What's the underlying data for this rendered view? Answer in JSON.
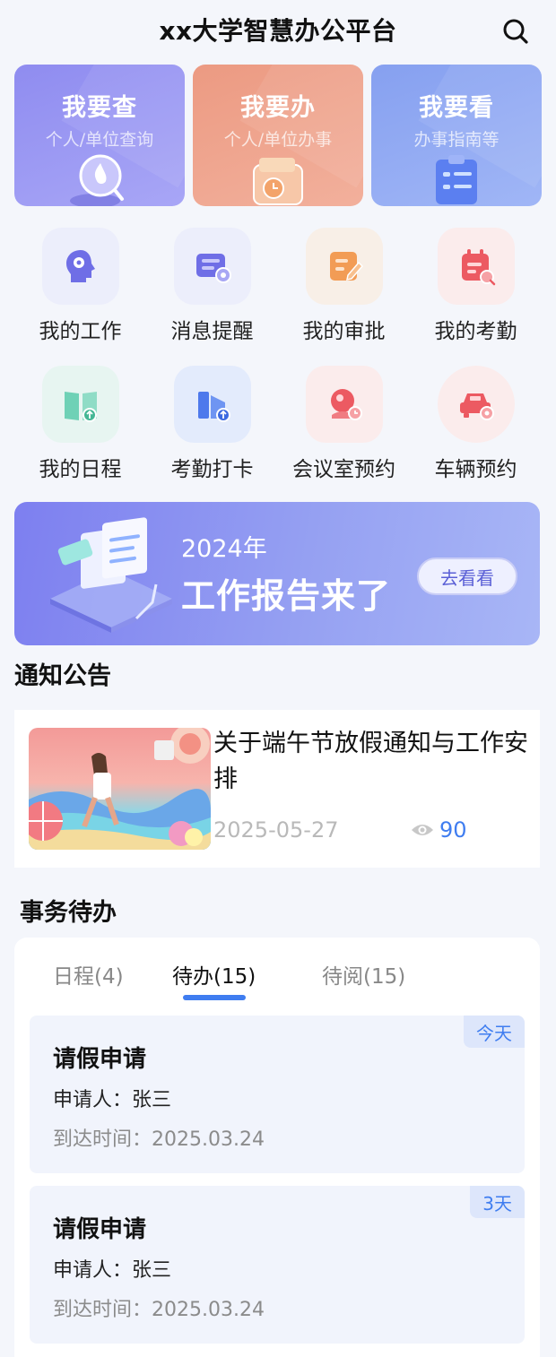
{
  "header": {
    "title": "xx大学智慧办公平台",
    "search_icon": "search-icon"
  },
  "top_cards": [
    {
      "title": "我要查",
      "subtitle": "个人/单位查询",
      "icon": "search-flame-icon",
      "color": "#8f8cf0"
    },
    {
      "title": "我要办",
      "subtitle": "个人/单位办事",
      "icon": "wallet-clock-icon",
      "color": "#ec9a82"
    },
    {
      "title": "我要看",
      "subtitle": "办事指南等",
      "icon": "guide-clipboard-icon",
      "color": "#86a0f0"
    }
  ],
  "quick_menu": [
    {
      "label": "我的工作",
      "icon": "work-profile-icon"
    },
    {
      "label": "消息提醒",
      "icon": "message-reminder-icon"
    },
    {
      "label": "我的审批",
      "icon": "approval-edit-icon"
    },
    {
      "label": "我的考勤",
      "icon": "attendance-calendar-icon"
    },
    {
      "label": "我的日程",
      "icon": "schedule-book-icon"
    },
    {
      "label": "考勤打卡",
      "icon": "clock-in-building-icon"
    },
    {
      "label": "会议室预约",
      "icon": "meeting-room-icon"
    },
    {
      "label": "车辆预约",
      "icon": "car-booking-icon"
    }
  ],
  "banner": {
    "year": "2024年",
    "title": "工作报告来了",
    "button": "去看看"
  },
  "notices": {
    "section_title": "通知公告",
    "items": [
      {
        "title": "关于端午节放假通知与工作安排",
        "date": "2025-05-27",
        "views": "90"
      }
    ]
  },
  "todo": {
    "section_title": "事务待办",
    "tabs": [
      {
        "label": "日程(4)",
        "active": false
      },
      {
        "label": "待办(15)",
        "active": true
      },
      {
        "label": "待阅(15)",
        "active": false
      }
    ],
    "items": [
      {
        "title": "请假申请",
        "applicant": "申请人：张三",
        "arrival": "到达时间：2025.03.24",
        "tag": "今天"
      },
      {
        "title": "请假申请",
        "applicant": "申请人：张三",
        "arrival": "到达时间：2025.03.24",
        "tag": "3天"
      }
    ]
  },
  "colors": {
    "accent": "#3f7df0",
    "banner": "#7d7ff0"
  }
}
